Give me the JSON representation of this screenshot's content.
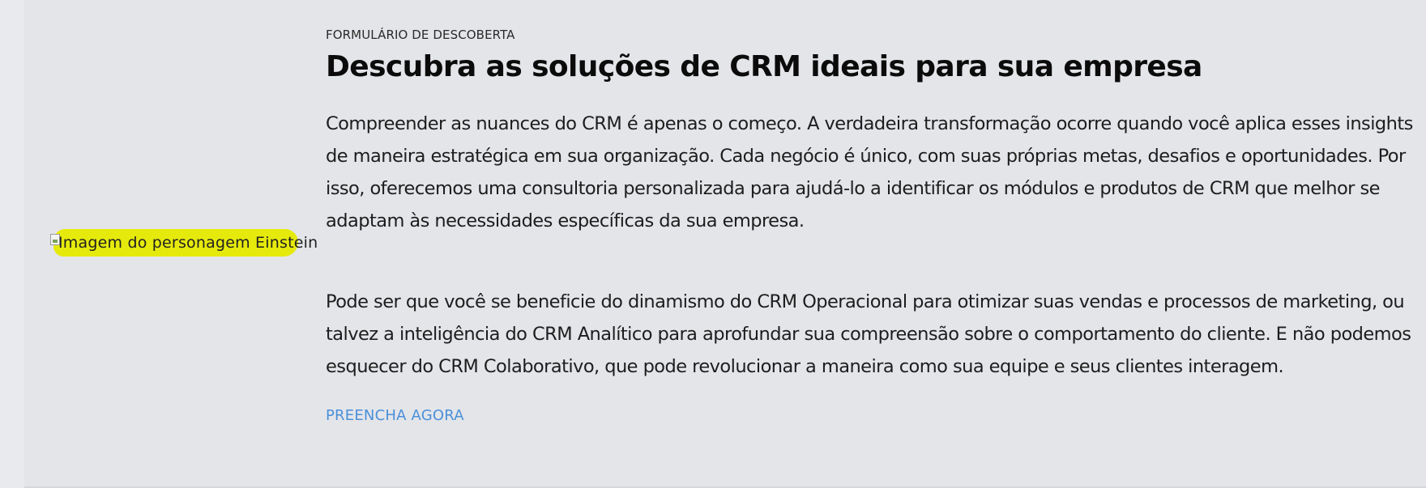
{
  "image": {
    "alt": "Imagem do personagem Einstein"
  },
  "section": {
    "eyebrow": "FORMULÁRIO DE DESCOBERTA",
    "title": "Descubra as soluções de CRM ideais para sua empresa",
    "paragraph_1": "Compreender as nuances do CRM é apenas o começo. A verdadeira transformação ocorre quando você aplica esses insights de maneira estratégica em sua organização. Cada negócio é único, com suas próprias metas, desafios e oportunidades. Por isso, oferecemos uma consultoria personalizada para ajudá-lo a identificar os módulos e produtos de CRM que melhor se adaptam às necessidades específicas da sua empresa.",
    "paragraph_2": "Pode ser que você se beneficie do dinamismo do CRM Operacional para otimizar suas vendas e processos de marketing, ou talvez a inteligência do CRM Analítico para aprofundar sua compreensão sobre o comportamento do cliente. E não podemos esquecer do CRM Colaborativo, que pode revolucionar a maneira como sua equipe e seus clientes interagem.",
    "cta_label": "PREENCHA AGORA"
  },
  "colors": {
    "background": "#e4e5e9",
    "highlight": "#e6ea00",
    "link": "#4a90d9",
    "text": "#1d1d1d"
  }
}
